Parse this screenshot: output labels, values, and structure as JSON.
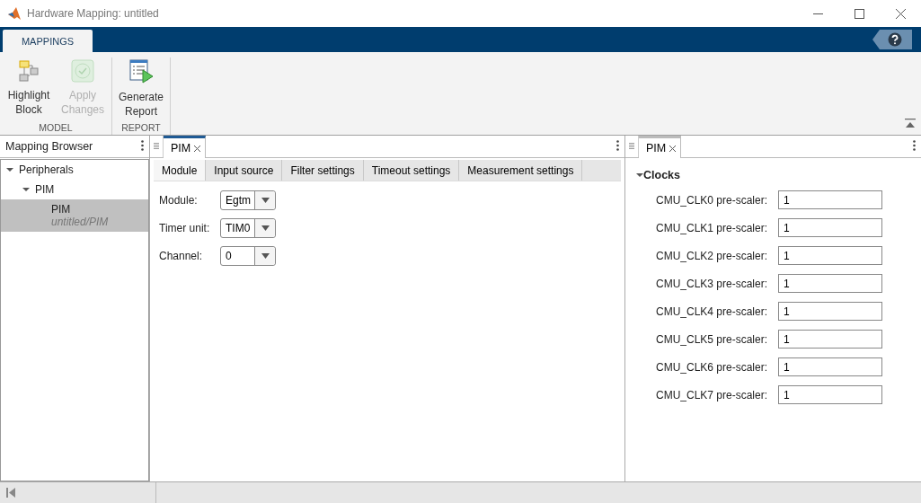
{
  "window": {
    "title": "Hardware Mapping: untitled"
  },
  "ribbon": {
    "tabs": [
      {
        "label": "MAPPINGS",
        "selected": true
      }
    ],
    "groups": [
      {
        "label": "MODEL",
        "buttons": [
          {
            "kind": "highlight",
            "lines": [
              "Highlight",
              "Block"
            ],
            "disabled": false
          },
          {
            "kind": "apply",
            "lines": [
              "Apply",
              "Changes"
            ],
            "disabled": true
          }
        ]
      },
      {
        "label": "REPORT",
        "buttons": [
          {
            "kind": "report",
            "lines": [
              "Generate",
              "Report"
            ],
            "disabled": false
          }
        ]
      }
    ]
  },
  "browser": {
    "title": "Mapping Browser",
    "tree": [
      {
        "label": "Peripherals",
        "expanded": true,
        "selected": false,
        "children": [
          {
            "label": "PIM",
            "expanded": true,
            "selected": false,
            "children": [
              {
                "label": "PIM",
                "sublabel": "untitled/PIM",
                "selected": true
              }
            ]
          }
        ]
      }
    ]
  },
  "editor": {
    "tabs": [
      {
        "label": "PIM",
        "selected": true
      }
    ],
    "subtabs": [
      {
        "label": "Module",
        "selected": true
      },
      {
        "label": "Input source",
        "selected": false
      },
      {
        "label": "Filter settings",
        "selected": false
      },
      {
        "label": "Timeout settings",
        "selected": false
      },
      {
        "label": "Measurement settings",
        "selected": false
      }
    ],
    "fields": [
      {
        "label": "Module:",
        "value": "Egtm"
      },
      {
        "label": "Timer unit:",
        "value": "TIM0"
      },
      {
        "label": "Channel:",
        "value": "0"
      }
    ]
  },
  "properties": {
    "tabs": [
      {
        "label": "PIM",
        "selected": false
      }
    ],
    "section": {
      "label": "Clocks",
      "expanded": true
    },
    "fields": [
      {
        "label": "CMU_CLK0 pre-scaler:",
        "value": "1"
      },
      {
        "label": "CMU_CLK1 pre-scaler:",
        "value": "1"
      },
      {
        "label": "CMU_CLK2 pre-scaler:",
        "value": "1"
      },
      {
        "label": "CMU_CLK3 pre-scaler:",
        "value": "1"
      },
      {
        "label": "CMU_CLK4 pre-scaler:",
        "value": "1"
      },
      {
        "label": "CMU_CLK5 pre-scaler:",
        "value": "1"
      },
      {
        "label": "CMU_CLK6 pre-scaler:",
        "value": "1"
      },
      {
        "label": "CMU_CLK7 pre-scaler:",
        "value": "1"
      }
    ]
  }
}
